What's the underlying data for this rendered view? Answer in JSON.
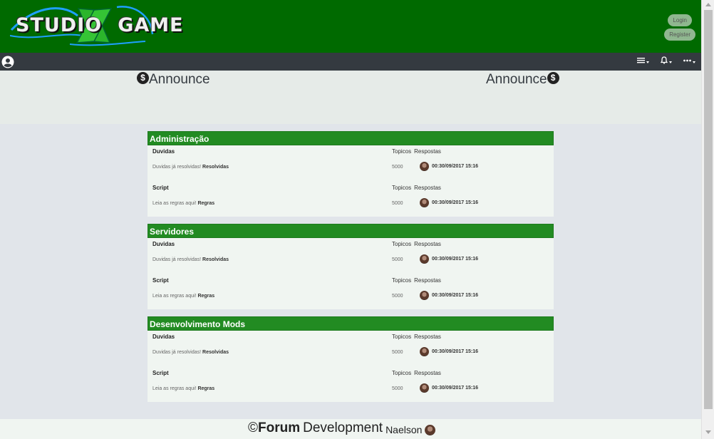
{
  "header": {
    "logo_text_left": "STUDIO",
    "logo_text_right": "GAME",
    "login_label": "Login",
    "register_label": "Register"
  },
  "navbar": {
    "user_icon": "user-circle-icon",
    "items": [
      {
        "icon": "menu-icon"
      },
      {
        "icon": "bell-icon"
      },
      {
        "icon": "more-icon"
      }
    ]
  },
  "announce": {
    "left_label": "Announce",
    "right_label": "Announce",
    "icon_glyph": "$"
  },
  "sections": [
    {
      "title": "Administração",
      "forums": [
        {
          "title": "Duvidas",
          "desc_prefix": "Duvidas já resolvidas!",
          "desc_link": "Resolvidas",
          "topics_label": "Topicos",
          "replies_label": "Respostas",
          "count": "5000",
          "last_post": "00:30/09/2017 15:16"
        },
        {
          "title": "Script",
          "desc_prefix": "Leia as regras aqui!",
          "desc_link": "Regras",
          "topics_label": "Topicos",
          "replies_label": "Respostas",
          "count": "5000",
          "last_post": "00:30/09/2017 15:16"
        }
      ]
    },
    {
      "title": "Servidores",
      "forums": [
        {
          "title": "Duvidas",
          "desc_prefix": "Duvidas já resolvidas!",
          "desc_link": "Resolvidas",
          "topics_label": "Topicos",
          "replies_label": "Respostas",
          "count": "5000",
          "last_post": "00:30/09/2017 15:16"
        },
        {
          "title": "Script",
          "desc_prefix": "Leia as regras aqui!",
          "desc_link": "Regras",
          "topics_label": "Topicos",
          "replies_label": "Respostas",
          "count": "5000",
          "last_post": "00:30/09/2017 15:16"
        }
      ]
    },
    {
      "title": "Desenvolvimento Mods",
      "forums": [
        {
          "title": "Duvidas",
          "desc_prefix": "Duvidas já resolvidas!",
          "desc_link": "Resolvidas",
          "topics_label": "Topicos",
          "replies_label": "Respostas",
          "count": "5000",
          "last_post": "00:30/09/2017 15:16"
        },
        {
          "title": "Script",
          "desc_prefix": "Leia as regras aqui!",
          "desc_link": "Regras",
          "topics_label": "Topicos",
          "replies_label": "Respostas",
          "count": "5000",
          "last_post": "00:30/09/2017 15:16"
        }
      ]
    }
  ],
  "footer": {
    "copyright": "©",
    "brand_bold": "Forum",
    "brand_rest": "Development",
    "author": "Naelson"
  },
  "colors": {
    "header_bg": "#006a00",
    "navbar_bg": "#343a40",
    "section_header_bg": "#228b22",
    "page_bg": "#e1e5ea"
  }
}
